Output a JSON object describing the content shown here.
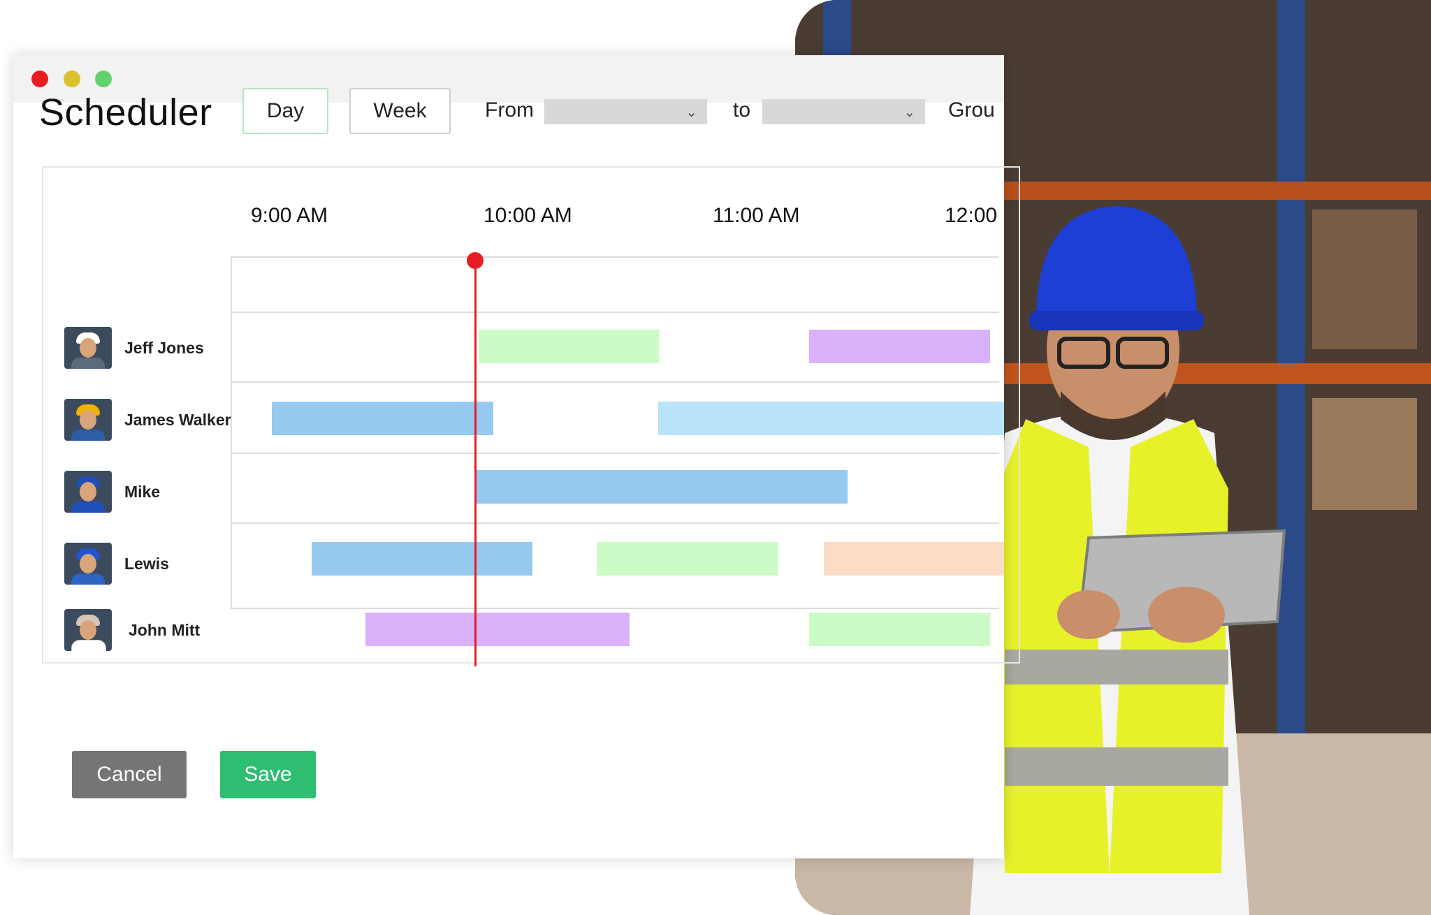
{
  "window": {
    "controls": [
      "close",
      "minimize",
      "maximize"
    ],
    "traffic_colors": [
      "#e81d24",
      "#dcc12e",
      "#62d26c"
    ]
  },
  "header": {
    "title": "Scheduler",
    "views": {
      "day": "Day",
      "week": "Week"
    },
    "from_label": "From",
    "to_label": "to",
    "group_label": "Grou",
    "from_value": "",
    "to_value": ""
  },
  "timeline": {
    "times": [
      "9:00 AM",
      "10:00 AM",
      "11:00 AM",
      "12:00"
    ],
    "now_indicator_color": "#e81d24"
  },
  "people": [
    {
      "name": "Jeff Jones",
      "helmet": "#ffffff",
      "shirt": "#5a6b7d"
    },
    {
      "name": "James Walker",
      "helmet": "#f0b400",
      "shirt": "#2d5da8"
    },
    {
      "name": "Mike",
      "helmet": "#1f4fb8",
      "shirt": "#1f4fb8"
    },
    {
      "name": "Lewis",
      "helmet": "#1f55cf",
      "shirt": "#2e63c4"
    },
    {
      "name": "John Mitt",
      "helmet": "#d7c7b8",
      "shirt": "#ffffff"
    }
  ],
  "event_colors": {
    "green": "#ccfcc6",
    "purple": "#d9b2fb",
    "blue": "#95c9ef",
    "light_blue": "#b8e3fb",
    "peach": "#fbdcc5"
  },
  "footer": {
    "cancel": "Cancel",
    "save": "Save"
  }
}
